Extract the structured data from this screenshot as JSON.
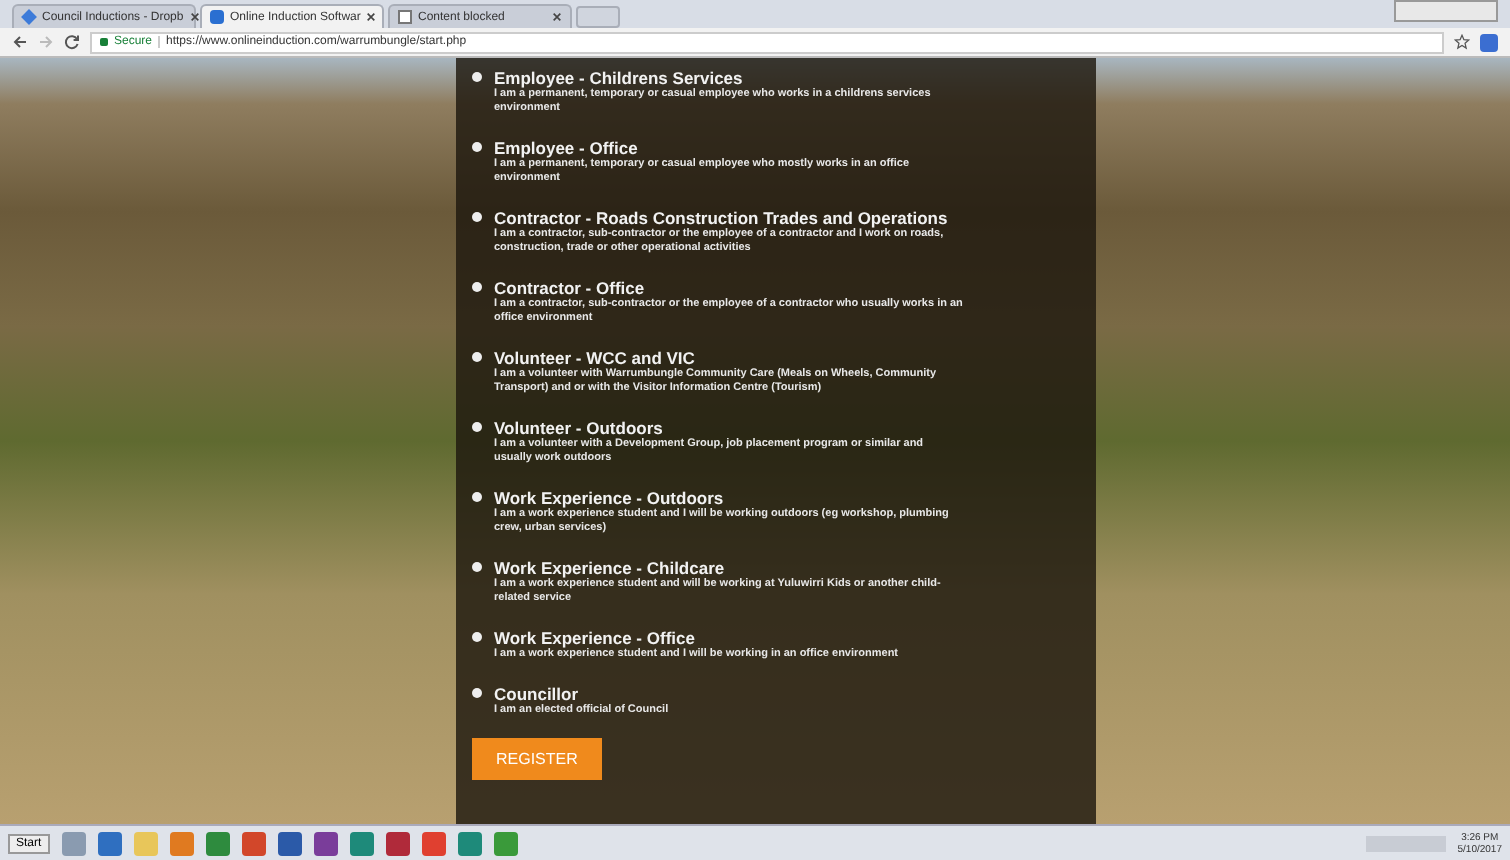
{
  "browser": {
    "tabs": [
      {
        "label": "Council Inductions - Dropb",
        "selected": false,
        "kind": "dropbox"
      },
      {
        "label": "Online Induction Softwar",
        "selected": true,
        "kind": "site"
      },
      {
        "label": "Content blocked",
        "selected": false,
        "kind": "page"
      }
    ],
    "secure_label": "Secure",
    "url": "https://www.onlineinduction.com/warrumbungle/start.php"
  },
  "options": [
    {
      "title": "Employee - Childrens Services",
      "description": "I am a permanent, temporary or casual employee who works in a childrens services environment"
    },
    {
      "title": "Employee - Office",
      "description": "I am a permanent, temporary or casual employee who mostly works in an office environment"
    },
    {
      "title": "Contractor - Roads Construction Trades and Operations",
      "description": "I am a contractor, sub-contractor or the employee of a contractor and I work on roads, construction, trade or other operational activities"
    },
    {
      "title": "Contractor - Office",
      "description": "I am a contractor, sub-contractor or the employee of a contractor who usually works in an office environment"
    },
    {
      "title": "Volunteer - WCC and VIC",
      "description": "I am a volunteer with Warrumbungle Community Care (Meals on Wheels, Community Transport) and or with the Visitor Information Centre (Tourism)"
    },
    {
      "title": "Volunteer - Outdoors",
      "description": "I am a volunteer with a Development Group, job placement program or similar and usually work outdoors"
    },
    {
      "title": "Work Experience - Outdoors",
      "description": "I am a work experience student and I will be working outdoors (eg workshop, plumbing crew, urban services)"
    },
    {
      "title": "Work Experience - Childcare",
      "description": "I am a work experience student and will be working at Yuluwirri Kids or another child-related service"
    },
    {
      "title": "Work Experience - Office",
      "description": "I am a work experience student and I will be working in an office environment"
    },
    {
      "title": "Councillor",
      "description": "I am an elected official of Council"
    }
  ],
  "register_button": "REGISTER",
  "taskbar": {
    "start": "Start",
    "apps": [
      {
        "color": "#8a9bb0"
      },
      {
        "color": "#2f6fc0"
      },
      {
        "color": "#e8c65a"
      },
      {
        "color": "#e07a20"
      },
      {
        "color": "#2e8b3e"
      },
      {
        "color": "#d2472a"
      },
      {
        "color": "#2b5aa8"
      },
      {
        "color": "#7a3d9a"
      },
      {
        "color": "#1e8a7a"
      },
      {
        "color": "#b02a3a"
      },
      {
        "color": "#e04030"
      },
      {
        "color": "#1e8a7a"
      },
      {
        "color": "#3a9a3a"
      }
    ],
    "time": "3:26 PM",
    "date": "5/10/2017"
  }
}
